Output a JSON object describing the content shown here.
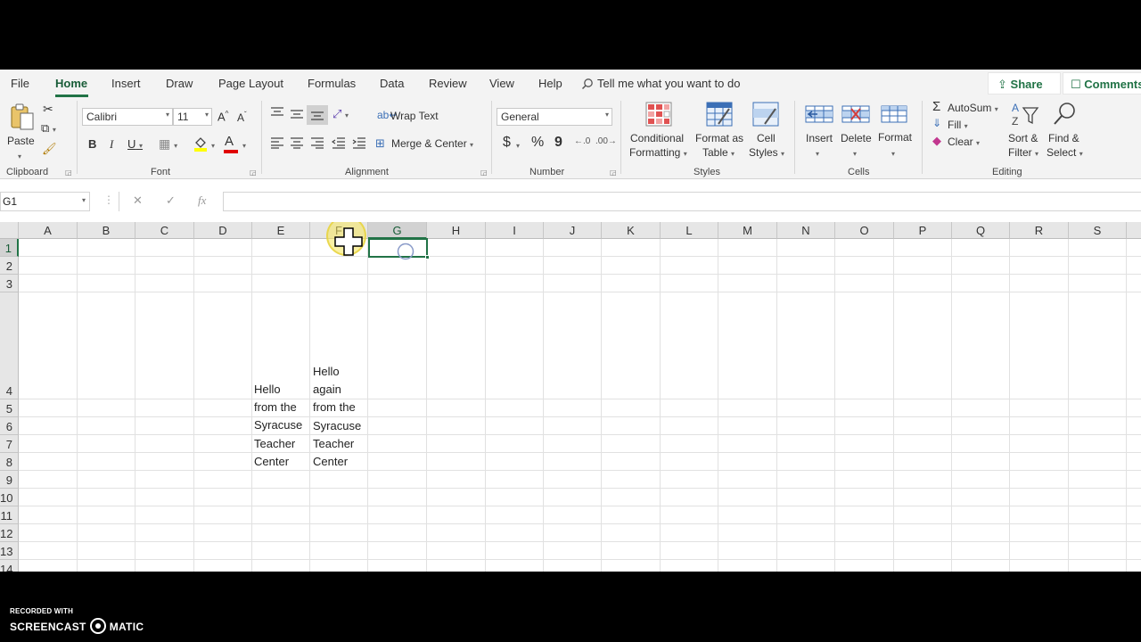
{
  "menu": {
    "tabs": [
      "File",
      "Home",
      "Insert",
      "Draw",
      "Page Layout",
      "Formulas",
      "Data",
      "Review",
      "View",
      "Help"
    ],
    "active_tab": "Home",
    "tell_me": "Tell me what you want to do",
    "share": "Share",
    "comments": "Comments"
  },
  "ribbon": {
    "clipboard": {
      "label": "Clipboard",
      "paste": "Paste"
    },
    "font": {
      "label": "Font",
      "name": "Calibri",
      "size": "11",
      "bold": "B",
      "italic": "I",
      "underline": "U",
      "grow": "A",
      "shrink": "A",
      "color_letter": "A"
    },
    "alignment": {
      "label": "Alignment",
      "wrap_text": "Wrap Text",
      "merge_center": "Merge & Center"
    },
    "number": {
      "label": "Number",
      "format": "General",
      "currency": "$",
      "percent": "%",
      "comma": "9"
    },
    "styles": {
      "label": "Styles",
      "conditional_1": "Conditional",
      "conditional_2": "Formatting",
      "format_table_1": "Format as",
      "format_table_2": "Table",
      "cell_styles_1": "Cell",
      "cell_styles_2": "Styles"
    },
    "cells": {
      "label": "Cells",
      "insert": "Insert",
      "delete": "Delete",
      "format": "Format"
    },
    "editing": {
      "label": "Editing",
      "autosum": "AutoSum",
      "fill": "Fill",
      "clear": "Clear",
      "sort_1": "Sort &",
      "sort_2": "Filter",
      "find_1": "Find &",
      "find_2": "Select"
    }
  },
  "formula_bar": {
    "name_box": "G1",
    "cancel": "✕",
    "enter": "✓",
    "fx": "fx",
    "value": ""
  },
  "grid": {
    "columns": [
      "A",
      "B",
      "C",
      "D",
      "E",
      "F",
      "G",
      "H",
      "I",
      "J",
      "K",
      "L",
      "M",
      "N",
      "O",
      "P",
      "Q",
      "R",
      "S"
    ],
    "selected_column": "G",
    "rows": [
      "1",
      "2",
      "3",
      "4",
      "5",
      "6",
      "7",
      "8",
      "9",
      "10",
      "11",
      "12",
      "13",
      "14"
    ],
    "selected_row": "1",
    "selected_cell": "G1",
    "cells": {
      "E4": [
        "Hello",
        "from the",
        "Syracuse",
        "Teacher",
        "Center"
      ],
      "F4": [
        "Hello",
        "again",
        "from the",
        "Syracuse",
        "Teacher",
        "Center"
      ]
    }
  },
  "watermark": {
    "line1": "RECORDED WITH",
    "line2a": "SCREENCAST",
    "line2b": "MATIC"
  },
  "colors": {
    "accent": "#217346",
    "menu_bg": "#f3f3f3",
    "header_bg": "#e6e6e6"
  }
}
